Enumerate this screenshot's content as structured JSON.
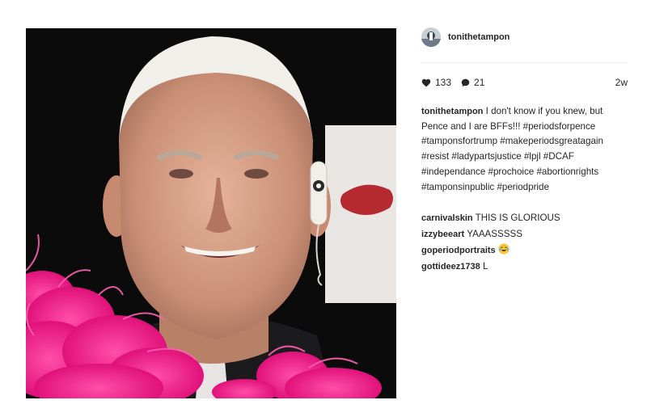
{
  "post": {
    "username": "tonithetampon",
    "likes": "133",
    "comments_count": "21",
    "time_ago": "2w",
    "caption_user": "tonithetampon",
    "caption_text": "I don't know if you knew, but Pence and I are BFFs!!! #periodsforpence #tamponsfortrump #makeperiodsgreatagain #resist #ladypartsjustice #lpjl #DCAF #independance #prochoice #abortionrights #tamponsinpublic #periodpride"
  },
  "comments": [
    {
      "user": "carnivalskin",
      "text": "THIS IS GLORIOUS"
    },
    {
      "user": "izzybeeart",
      "text": "YAAASSSSS"
    },
    {
      "user": "goperiodportraits",
      "text": "",
      "emoji": "laughing-tears-emoji"
    },
    {
      "user": "gottideez1738",
      "text": "L"
    }
  ],
  "icons": {
    "like": "heart-icon",
    "comment": "speech-bubble-icon"
  },
  "colors": {
    "boa": "#ff1f8e",
    "text": "#262626",
    "divider": "#efefef"
  }
}
